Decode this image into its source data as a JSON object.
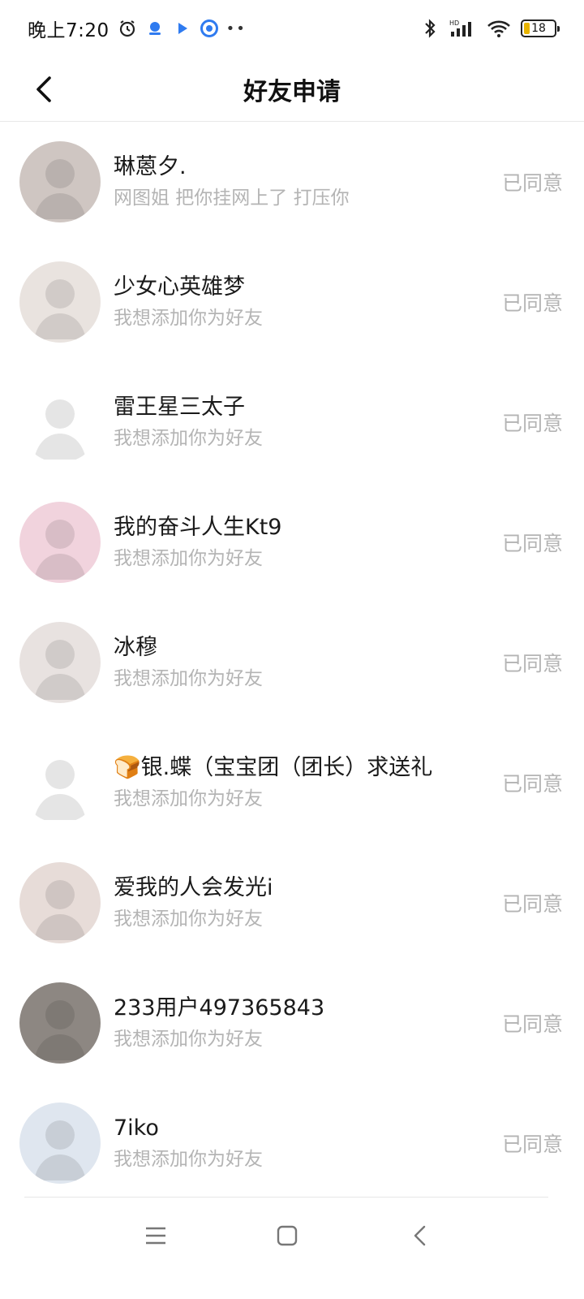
{
  "status_bar": {
    "time": "晚上7:20",
    "icons": [
      "alarm-icon",
      "app-notification-icon",
      "play-icon",
      "circle-app-icon",
      "more-dots-icon",
      "bluetooth-icon",
      "hd-signal-icon",
      "wifi-icon"
    ],
    "battery": "18"
  },
  "header": {
    "title": "好友申请",
    "back_icon": "chevron-left-icon"
  },
  "requests": [
    {
      "name": "琳蒽夕.",
      "message": "网图姐 把你挂网上了 打压你",
      "status": "已同意",
      "avatar_color": "#cfc6c2"
    },
    {
      "name": "少女心英雄梦",
      "message": "我想添加你为好友",
      "status": "已同意",
      "avatar_color": "#e9e3df"
    },
    {
      "name": "雷王星三太子",
      "message": "我想添加你为好友",
      "status": "已同意",
      "avatar_color": "#ffffff"
    },
    {
      "name": "我的奋斗人生Kt9",
      "message": "我想添加你为好友",
      "status": "已同意",
      "avatar_color": "#f1d3dd"
    },
    {
      "name": "冰穆",
      "message": "我想添加你为好友",
      "status": "已同意",
      "avatar_color": "#e8e2e0"
    },
    {
      "name": "🍞银.蝶（宝宝团（团长）求送礼",
      "message": "我想添加你为好友",
      "status": "已同意",
      "avatar_color": "#ffffff"
    },
    {
      "name": "爱我的人会发光i",
      "message": "我想添加你为好友",
      "status": "已同意",
      "avatar_color": "#e7dcd8"
    },
    {
      "name": "233用户497365843",
      "message": "我想添加你为好友",
      "status": "已同意",
      "avatar_color": "#8d8782"
    },
    {
      "name": "7iko",
      "message": "我想添加你为好友",
      "status": "已同意",
      "avatar_color": "#dfe6ef"
    }
  ],
  "nav_bar": {
    "icons": [
      "menu-icon",
      "home-square-icon",
      "back-triangle-icon"
    ]
  }
}
